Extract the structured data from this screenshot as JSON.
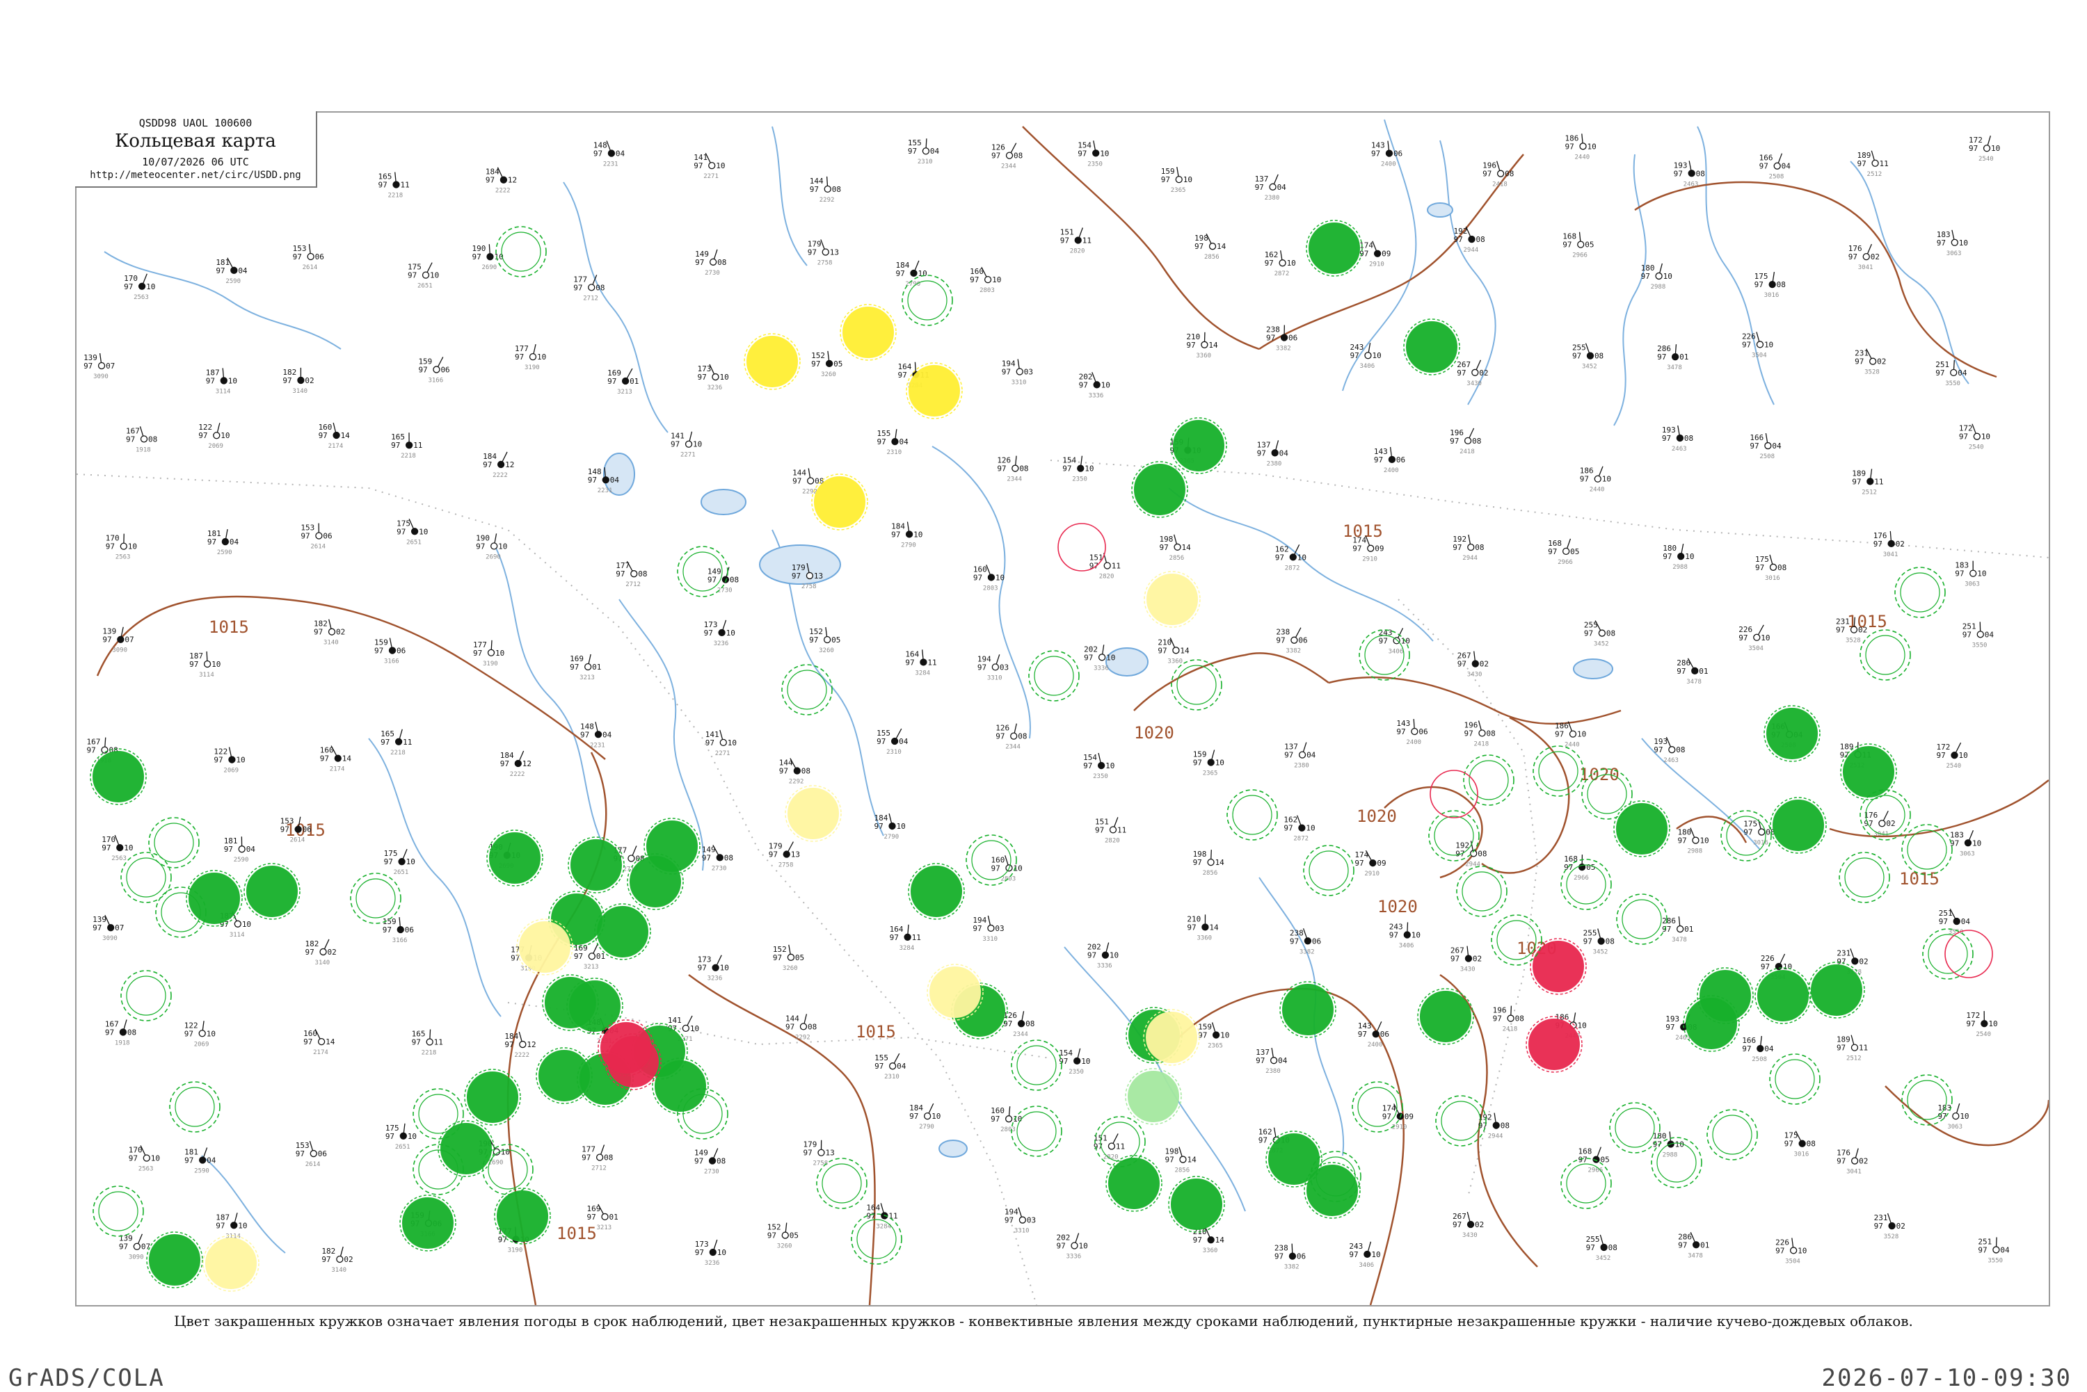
{
  "header": {
    "code": "QSDD98  UAOL  100600",
    "title": "Кольцевая карта",
    "date": "10/07/2026 06 UTC",
    "url": "http://meteocenter.net/circ/USDD.png"
  },
  "caption": "Цвет закрашенных кружков означает явления погоды в срок наблюдений, цвет незакрашенных кружков - конвективные явления между сроками наблюдений, пунктирные незакрашенные кружки - наличие кучево-дождевых облаков.",
  "footer": {
    "left": "GrADS/COLA",
    "right": "2026-07-10-09:30"
  },
  "colors": {
    "rain": "#17b02b",
    "shower_light": "#a5e8a0",
    "fog": "#ffef33",
    "fog_light": "#fff6a0",
    "thunder": "#e8284f",
    "isobar": "#a0522d",
    "rivers": "#6fa8dc",
    "borders": "#b4b4b4"
  },
  "isobars": [
    {
      "label": "1015"
    },
    {
      "label": "1015"
    },
    {
      "label": "1015"
    },
    {
      "label": "1015"
    },
    {
      "label": "1015"
    },
    {
      "label": "1015"
    },
    {
      "label": "1020"
    },
    {
      "label": "1020"
    },
    {
      "label": "1020"
    },
    {
      "label": "1020"
    },
    {
      "label": "1020"
    },
    {
      "label": "1015"
    }
  ],
  "sample_stations": [
    {
      "p": "167",
      "t": "97",
      "d": "08",
      "idx": "1918"
    },
    {
      "p": "122",
      "t": "97",
      "d": "10",
      "idx": "2069"
    },
    {
      "p": "160",
      "t": "97",
      "d": "14",
      "idx": "2174"
    },
    {
      "p": "165",
      "t": "97",
      "d": "11",
      "idx": "2218"
    },
    {
      "p": "184",
      "t": "97",
      "d": "12",
      "idx": "2222"
    },
    {
      "p": "148",
      "t": "97",
      "d": "04",
      "idx": "2231"
    },
    {
      "p": "141",
      "t": "97",
      "d": "10",
      "idx": "2271"
    },
    {
      "p": "144",
      "t": "97",
      "d": "08",
      "idx": "2292"
    },
    {
      "p": "155",
      "t": "97",
      "d": "04",
      "idx": "2310"
    },
    {
      "p": "126",
      "t": "97",
      "d": "08",
      "idx": "2344"
    },
    {
      "p": "154",
      "t": "97",
      "d": "10",
      "idx": "2350"
    },
    {
      "p": "159",
      "t": "97",
      "d": "10",
      "idx": "2365"
    },
    {
      "p": "137",
      "t": "97",
      "d": "04",
      "idx": "2380"
    },
    {
      "p": "143",
      "t": "97",
      "d": "06",
      "idx": "2400"
    },
    {
      "p": "196",
      "t": "97",
      "d": "08",
      "idx": "2418"
    },
    {
      "p": "186",
      "t": "97",
      "d": "10",
      "idx": "2440"
    },
    {
      "p": "193",
      "t": "97",
      "d": "08",
      "idx": "2463"
    },
    {
      "p": "166",
      "t": "97",
      "d": "04",
      "idx": "2508"
    },
    {
      "p": "189",
      "t": "97",
      "d": "11",
      "idx": "2512"
    },
    {
      "p": "172",
      "t": "97",
      "d": "10",
      "idx": "2540"
    },
    {
      "p": "170",
      "t": "97",
      "d": "10",
      "idx": "2563"
    },
    {
      "p": "181",
      "t": "97",
      "d": "04",
      "idx": "2590"
    },
    {
      "p": "153",
      "t": "97",
      "d": "06",
      "idx": "2614"
    },
    {
      "p": "175",
      "t": "97",
      "d": "10",
      "idx": "2651"
    },
    {
      "p": "190",
      "t": "97",
      "d": "10",
      "idx": "2690"
    },
    {
      "p": "177",
      "t": "97",
      "d": "08",
      "idx": "2712"
    },
    {
      "p": "149",
      "t": "97",
      "d": "08",
      "idx": "2730"
    },
    {
      "p": "179",
      "t": "97",
      "d": "13",
      "idx": "2758"
    },
    {
      "p": "184",
      "t": "97",
      "d": "10",
      "idx": "2790"
    },
    {
      "p": "160",
      "t": "97",
      "d": "10",
      "idx": "2803"
    },
    {
      "p": "151",
      "t": "97",
      "d": "11",
      "idx": "2820"
    },
    {
      "p": "198",
      "t": "97",
      "d": "14",
      "idx": "2856"
    },
    {
      "p": "162",
      "t": "97",
      "d": "10",
      "idx": "2872"
    },
    {
      "p": "174",
      "t": "97",
      "d": "09",
      "idx": "2910"
    },
    {
      "p": "192",
      "t": "97",
      "d": "08",
      "idx": "2944"
    },
    {
      "p": "168",
      "t": "97",
      "d": "05",
      "idx": "2966"
    },
    {
      "p": "180",
      "t": "97",
      "d": "10",
      "idx": "2988"
    },
    {
      "p": "175",
      "t": "97",
      "d": "08",
      "idx": "3016"
    },
    {
      "p": "176",
      "t": "97",
      "d": "02",
      "idx": "3041"
    },
    {
      "p": "183",
      "t": "97",
      "d": "10",
      "idx": "3063"
    },
    {
      "p": "139",
      "t": "97",
      "d": "07",
      "idx": "3090"
    },
    {
      "p": "187",
      "t": "97",
      "d": "10",
      "idx": "3114"
    },
    {
      "p": "182",
      "t": "97",
      "d": "02",
      "idx": "3140"
    },
    {
      "p": "159",
      "t": "97",
      "d": "06",
      "idx": "3166"
    },
    {
      "p": "177",
      "t": "97",
      "d": "10",
      "idx": "3190"
    },
    {
      "p": "169",
      "t": "97",
      "d": "01",
      "idx": "3213"
    },
    {
      "p": "173",
      "t": "97",
      "d": "10",
      "idx": "3236"
    },
    {
      "p": "152",
      "t": "97",
      "d": "05",
      "idx": "3260"
    },
    {
      "p": "164",
      "t": "97",
      "d": "11",
      "idx": "3284"
    },
    {
      "p": "194",
      "t": "97",
      "d": "03",
      "idx": "3310"
    },
    {
      "p": "202",
      "t": "97",
      "d": "10",
      "idx": "3336"
    },
    {
      "p": "210",
      "t": "97",
      "d": "14",
      "idx": "3360"
    },
    {
      "p": "238",
      "t": "97",
      "d": "06",
      "idx": "3382"
    },
    {
      "p": "243",
      "t": "97",
      "d": "10",
      "idx": "3406"
    },
    {
      "p": "267",
      "t": "97",
      "d": "02",
      "idx": "3430"
    },
    {
      "p": "255",
      "t": "97",
      "d": "08",
      "idx": "3452"
    },
    {
      "p": "286",
      "t": "97",
      "d": "01",
      "idx": "3478"
    },
    {
      "p": "226",
      "t": "97",
      "d": "10",
      "idx": "3504"
    },
    {
      "p": "231",
      "t": "97",
      "d": "02",
      "idx": "3528"
    },
    {
      "p": "251",
      "t": "97",
      "d": "04",
      "idx": "3550"
    }
  ]
}
